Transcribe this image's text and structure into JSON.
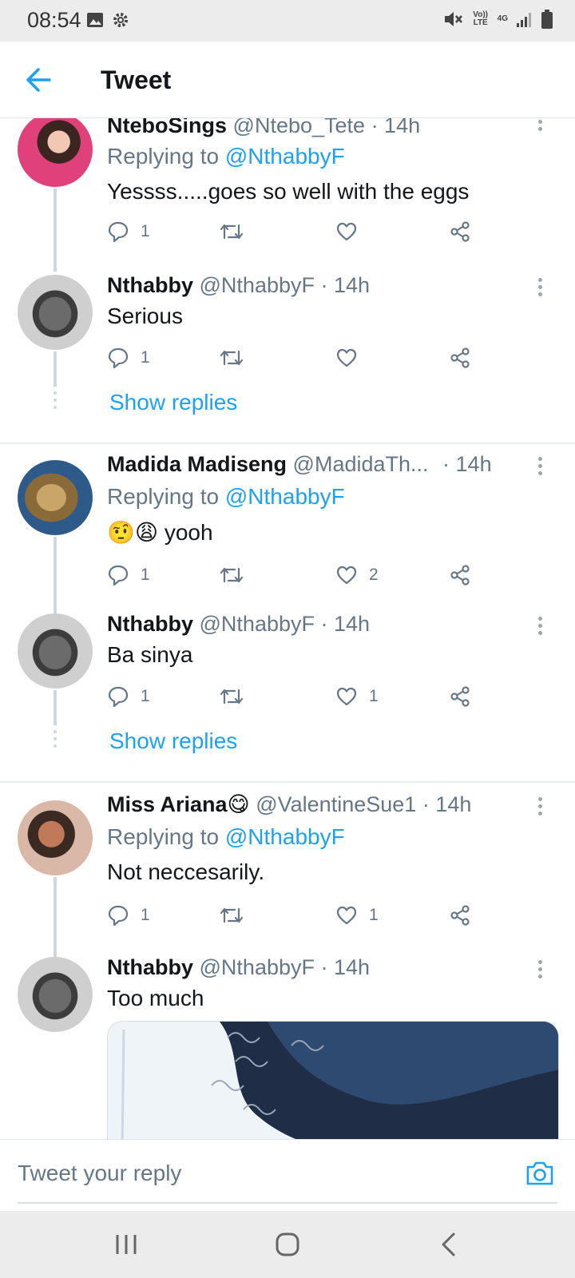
{
  "status_bar": {
    "time": "08:54",
    "volte_label": "Vo)) LTE",
    "network_label": "4G"
  },
  "header": {
    "title": "Tweet"
  },
  "tweets": [
    {
      "name": "NteboSings",
      "handle": "@Ntebo_Tete",
      "time": "· 14h",
      "replying_prefix": "Replying to ",
      "replying_handle": "@NthabbyF",
      "text": "Yessss.....goes so well with the eggs",
      "reply_count": "1",
      "retweet_count": "",
      "like_count": ""
    },
    {
      "name": "Nthabby",
      "handle": "@NthabbyF",
      "time": "· 14h",
      "text": "Serious",
      "reply_count": "1",
      "retweet_count": "",
      "like_count": "",
      "show_replies": "Show replies"
    },
    {
      "name": "Madida Madiseng",
      "handle": "@MadidaTh...",
      "time": "· 14h",
      "replying_prefix": "Replying to ",
      "replying_handle": "@NthabbyF",
      "text": "🤨😩 yooh",
      "reply_count": "1",
      "retweet_count": "",
      "like_count": "2"
    },
    {
      "name": "Nthabby",
      "handle": "@NthabbyF",
      "time": "· 14h",
      "text": "Ba sinya",
      "reply_count": "1",
      "retweet_count": "",
      "like_count": "1",
      "show_replies": "Show replies"
    },
    {
      "name": "Miss Ariana😋",
      "handle": "@ValentineSue1",
      "time": "· 14h",
      "replying_prefix": "Replying to ",
      "replying_handle": "@NthabbyF",
      "text": "Not neccesarily.",
      "reply_count": "1",
      "retweet_count": "",
      "like_count": "1"
    },
    {
      "name": "Nthabby",
      "handle": "@NthabbyF",
      "time": "· 14h",
      "text": "Too much"
    }
  ],
  "reply_bar": {
    "placeholder": "Tweet your reply"
  },
  "colors": {
    "accent": "#1da1f2",
    "secondary_text": "#657786",
    "divider": "#e6ecf0"
  },
  "icons": {
    "back": "arrow-left-icon",
    "reply": "speech-bubble-icon",
    "retweet": "retweet-icon",
    "like": "heart-icon",
    "share": "share-icon",
    "camera": "camera-icon"
  }
}
